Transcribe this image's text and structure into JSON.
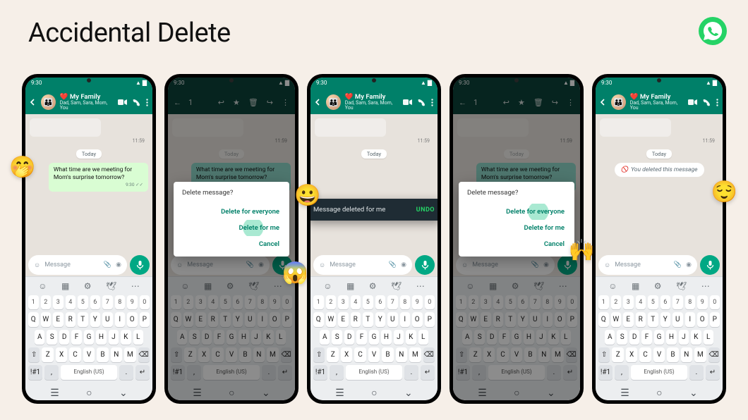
{
  "title": "Accidental Delete",
  "chat": {
    "name_prefix": "❤️ ",
    "name": "My Family",
    "subtitle": "Dad, Sam, Sara, Mom, You",
    "time": "9:30",
    "date_pill": "Today",
    "prev_time": "11:59",
    "message_text": "What time are we meeting for Mom's surprise tomorrow?",
    "message_meta": "9:30 ✓✓",
    "deleted_text": "You deleted this message",
    "input_placeholder": "Message",
    "selection_count": "1"
  },
  "dialog": {
    "title": "Delete message?",
    "opt1": "Delete for everyone",
    "opt2": "Delete for me",
    "opt3": "Cancel"
  },
  "toast": {
    "text": "Message deleted for me",
    "undo": "UNDO"
  },
  "keyboard": {
    "numbers": [
      "1",
      "2",
      "3",
      "4",
      "5",
      "6",
      "7",
      "8",
      "9",
      "0"
    ],
    "row1": [
      "Q",
      "W",
      "E",
      "R",
      "T",
      "Y",
      "U",
      "I",
      "O",
      "P"
    ],
    "row2": [
      "A",
      "S",
      "D",
      "F",
      "G",
      "H",
      "J",
      "K",
      "L"
    ],
    "row3": [
      "Z",
      "X",
      "C",
      "V",
      "B",
      "N",
      "M"
    ],
    "shift": "⇧",
    "backspace": "⌫",
    "symbols": "!#1",
    "comma": ",",
    "space": "English (US)",
    "period": ".",
    "enter": "↵"
  },
  "emojis": {
    "p1": "🤭",
    "p2": "😱",
    "p3": "😀",
    "p4": "🙌",
    "p5": "😌"
  }
}
